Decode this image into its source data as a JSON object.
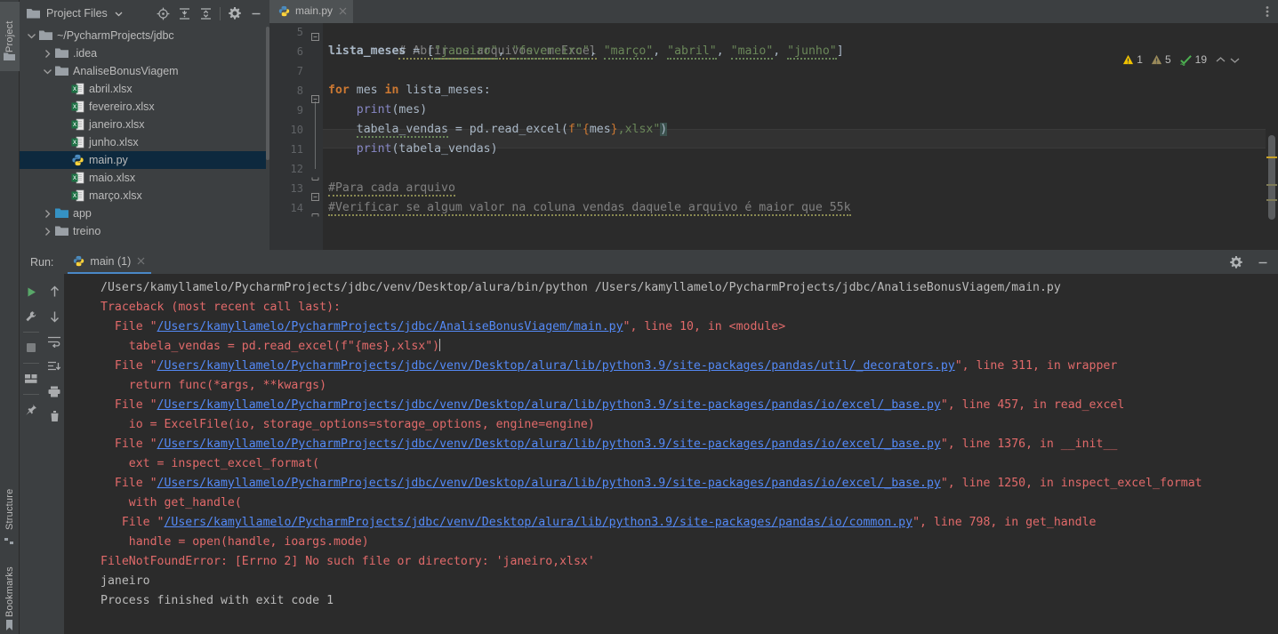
{
  "left_toolbar": {
    "project_tab": "Project",
    "structure_tab": "Structure",
    "bookmarks_tab": "Bookmarks"
  },
  "project_panel": {
    "title": "Project Files",
    "buttons": [
      {
        "name": "select-opened-file-icon",
        "label": "Select Opened File"
      },
      {
        "name": "expand-all-icon",
        "label": "Expand All"
      },
      {
        "name": "collapse-all-icon",
        "label": "Collapse All"
      },
      {
        "name": "settings-gear-icon",
        "label": "Settings"
      },
      {
        "name": "hide-panel-icon",
        "label": "Hide"
      }
    ],
    "tree": [
      {
        "label": "~/PycharmProjects/jdbc",
        "depth": 0,
        "arrow": "down",
        "icon": "folder",
        "selected": false
      },
      {
        "label": ".idea",
        "depth": 1,
        "arrow": "right",
        "icon": "folder",
        "selected": false
      },
      {
        "label": "AnaliseBonusViagem",
        "depth": 1,
        "arrow": "down",
        "icon": "folder",
        "selected": false
      },
      {
        "label": "abril.xlsx",
        "depth": 2,
        "arrow": "none",
        "icon": "xlsx",
        "selected": false
      },
      {
        "label": "fevereiro.xlsx",
        "depth": 2,
        "arrow": "none",
        "icon": "xlsx",
        "selected": false
      },
      {
        "label": "janeiro.xlsx",
        "depth": 2,
        "arrow": "none",
        "icon": "xlsx",
        "selected": false
      },
      {
        "label": "junho.xlsx",
        "depth": 2,
        "arrow": "none",
        "icon": "xlsx",
        "selected": false
      },
      {
        "label": "main.py",
        "depth": 2,
        "arrow": "none",
        "icon": "python",
        "selected": true
      },
      {
        "label": "maio.xlsx",
        "depth": 2,
        "arrow": "none",
        "icon": "xlsx",
        "selected": false
      },
      {
        "label": "março.xlsx",
        "depth": 2,
        "arrow": "none",
        "icon": "xlsx",
        "selected": false
      },
      {
        "label": "app",
        "depth": 1,
        "arrow": "right",
        "icon": "folder-source",
        "selected": false
      },
      {
        "label": "treino",
        "depth": 1,
        "arrow": "right",
        "icon": "folder",
        "selected": false
      }
    ]
  },
  "editor": {
    "tab": {
      "label": "main.py",
      "icon": "python-file-icon"
    },
    "inspections": {
      "warning_count": "1",
      "weak_warning_count": "5",
      "ok_count": "19"
    },
    "lines": [
      {
        "num": "5",
        "text": "# Abrir os arquivos em Excel"
      },
      {
        "num": "6",
        "text": "lista_meses = [\"janeiro\", \"fevereiro\", \"março\", \"abril\", \"maio\", \"junho\"]"
      },
      {
        "num": "7",
        "text": ""
      },
      {
        "num": "8",
        "text": "for mes in lista_meses:"
      },
      {
        "num": "9",
        "text": "    print(mes)"
      },
      {
        "num": "10",
        "text": "    tabela_vendas = pd.read_excel(f\"{mes},xlsx\")"
      },
      {
        "num": "11",
        "text": "    print(tabela_vendas)"
      },
      {
        "num": "12",
        "text": ""
      },
      {
        "num": "13",
        "text": "#Para cada arquivo"
      },
      {
        "num": "14",
        "text": "#Verificar se algum valor na coluna vendas daquele arquivo é maior que 55k"
      }
    ]
  },
  "run_panel": {
    "label": "Run:",
    "tab_label": "main (1)",
    "tools": [
      {
        "name": "rerun-button",
        "label": "Rerun"
      },
      {
        "name": "run-configuration-button",
        "label": "Modify Run Configuration"
      },
      {
        "name": "stop-button",
        "label": "Stop"
      },
      {
        "name": "console-layout-button",
        "label": "Layout"
      },
      {
        "name": "pin-tab-button",
        "label": "Pin Tab"
      }
    ],
    "tools2": [
      {
        "name": "up-arrow-button",
        "label": "Up"
      },
      {
        "name": "down-arrow-button",
        "label": "Down"
      },
      {
        "name": "soft-wrap-button",
        "label": "Soft-Wrap"
      },
      {
        "name": "scroll-to-end-button",
        "label": "Scroll to End"
      },
      {
        "name": "print-button",
        "label": "Print"
      },
      {
        "name": "clear-all-button",
        "label": "Clear All"
      }
    ],
    "header_buttons": [
      {
        "name": "settings-gear-icon",
        "label": "Settings"
      },
      {
        "name": "hide-panel-icon",
        "label": "Hide"
      }
    ],
    "console": [
      {
        "kind": "plain",
        "text": "/Users/kamyllamelo/PycharmProjects/jdbc/venv/Desktop/alura/bin/python /Users/kamyllamelo/PycharmProjects/jdbc/AnaliseBonusViagem/main.py"
      },
      {
        "kind": "err",
        "text": "Traceback (most recent call last):"
      },
      {
        "kind": "file",
        "indent": "  ",
        "pre": "File \"",
        "link": "/Users/kamyllamelo/PycharmProjects/jdbc/AnaliseBonusViagem/main.py",
        "post": "\", line 10, in <module>"
      },
      {
        "kind": "err",
        "text": "    tabela_vendas = pd.read_excel(f\"{mes},xlsx\")",
        "caret": true
      },
      {
        "kind": "file",
        "indent": "  ",
        "pre": "File \"",
        "link": "/Users/kamyllamelo/PycharmProjects/jdbc/venv/Desktop/alura/lib/python3.9/site-packages/pandas/util/_decorators.py",
        "post": "\", line 311, in wrapper"
      },
      {
        "kind": "err",
        "text": "    return func(*args, **kwargs)"
      },
      {
        "kind": "file",
        "indent": "  ",
        "pre": "File \"",
        "link": "/Users/kamyllamelo/PycharmProjects/jdbc/venv/Desktop/alura/lib/python3.9/site-packages/pandas/io/excel/_base.py",
        "post": "\", line 457, in read_excel"
      },
      {
        "kind": "err",
        "text": "    io = ExcelFile(io, storage_options=storage_options, engine=engine)"
      },
      {
        "kind": "file",
        "indent": "  ",
        "pre": "File \"",
        "link": "/Users/kamyllamelo/PycharmProjects/jdbc/venv/Desktop/alura/lib/python3.9/site-packages/pandas/io/excel/_base.py",
        "post": "\", line 1376, in __init__"
      },
      {
        "kind": "err",
        "text": "    ext = inspect_excel_format("
      },
      {
        "kind": "file",
        "indent": "  ",
        "pre": "File \"",
        "link": "/Users/kamyllamelo/PycharmProjects/jdbc/venv/Desktop/alura/lib/python3.9/site-packages/pandas/io/excel/_base.py",
        "post": "\", line 1250, in inspect_excel_format"
      },
      {
        "kind": "err",
        "text": "    with get_handle("
      },
      {
        "kind": "file",
        "indent": "   ",
        "pre": "File \"",
        "link": "/Users/kamyllamelo/PycharmProjects/jdbc/venv/Desktop/alura/lib/python3.9/site-packages/pandas/io/common.py",
        "post": "\", line 798, in get_handle"
      },
      {
        "kind": "err",
        "text": "    handle = open(handle, ioargs.mode)"
      },
      {
        "kind": "err",
        "text": "FileNotFoundError: [Errno 2] No such file or directory: 'janeiro,xlsx'"
      },
      {
        "kind": "plain",
        "text": "janeiro"
      },
      {
        "kind": "plain",
        "text": ""
      },
      {
        "kind": "plain",
        "text": "Process finished with exit code 1"
      }
    ]
  },
  "colors": {
    "panel_bg": "#3c3f41",
    "editor_bg": "#2b2b2b",
    "selection_blue": "#0d293e",
    "accent_blue": "#4a88c7",
    "keyword_orange": "#cc7832",
    "string_green": "#6a8759",
    "error_red": "#e16a6a",
    "link_blue": "#548af7",
    "text_gray": "#bbbbbb"
  }
}
